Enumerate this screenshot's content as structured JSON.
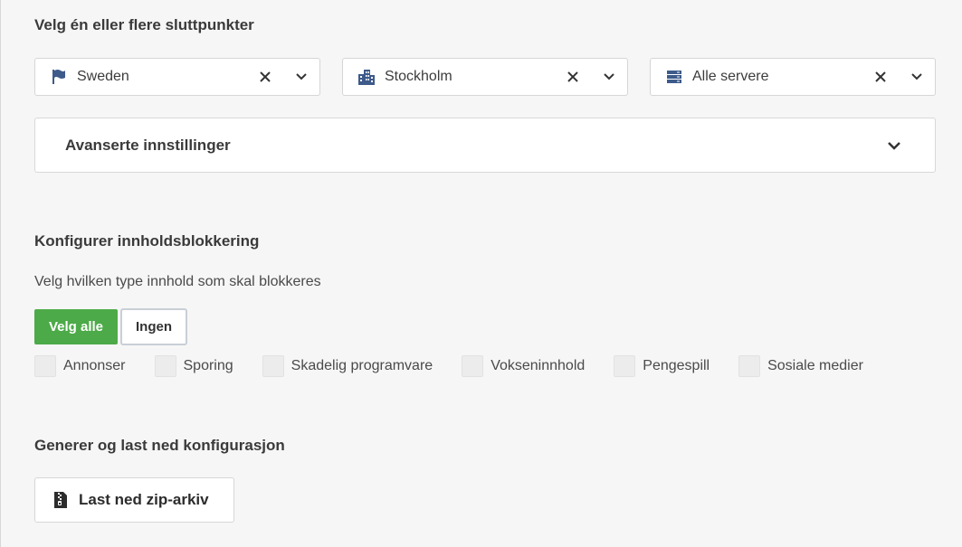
{
  "endpoints": {
    "title": "Velg én eller flere sluttpunkter",
    "country": {
      "value": "Sweden",
      "icon": "flag-icon"
    },
    "city": {
      "value": "Stockholm",
      "icon": "city-icon"
    },
    "server": {
      "value": "Alle servere",
      "icon": "server-icon"
    },
    "advanced_label": "Avanserte innstillinger"
  },
  "blocking": {
    "title": "Konfigurer innholdsblokkering",
    "subtitle": "Velg hvilken type innhold som skal blokkeres",
    "select_all_label": "Velg alle",
    "none_label": "Ingen",
    "categories": [
      "Annonser",
      "Sporing",
      "Skadelig programvare",
      "Vokseninnhold",
      "Pengespill",
      "Sosiale medier"
    ]
  },
  "generate": {
    "title": "Generer og last ned konfigurasjon",
    "download_label": "Last ned zip-arkiv",
    "download_icon": "zip-file-icon"
  },
  "colors": {
    "accent_green": "#4caa48",
    "icon_blue": "#3d5a8a"
  }
}
